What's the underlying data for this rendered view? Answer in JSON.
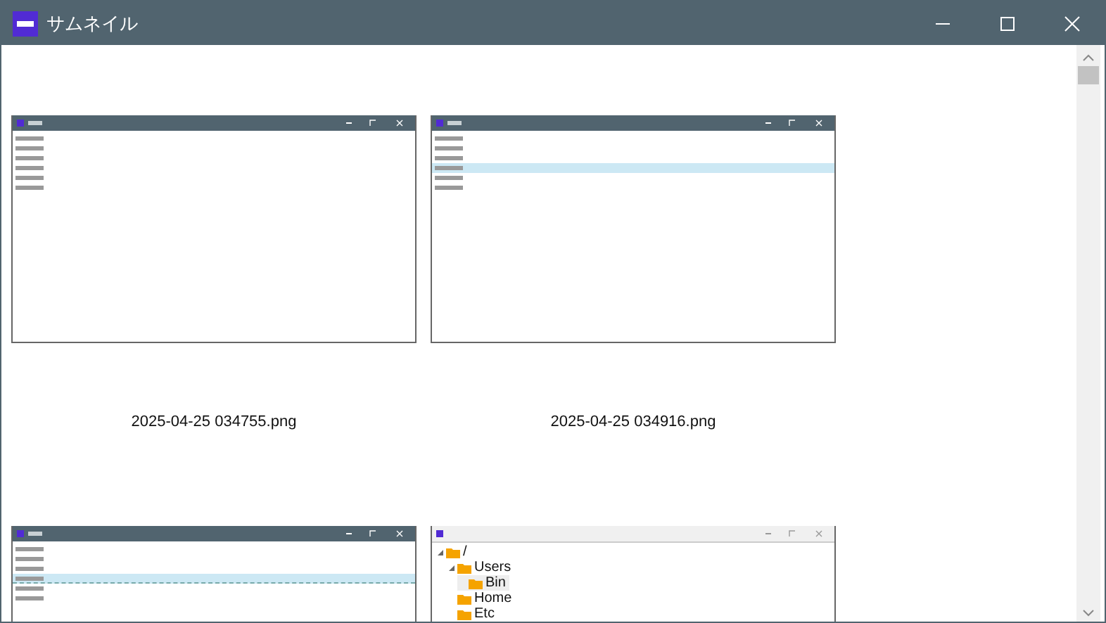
{
  "window": {
    "title": "サムネイル"
  },
  "thumbnails": [
    {
      "kind": "list",
      "caption": "2025-04-25 034755.png",
      "rows": [
        {
          "selected": false,
          "editing": false
        },
        {
          "selected": false,
          "editing": false
        },
        {
          "selected": false,
          "editing": false
        },
        {
          "selected": false,
          "editing": false
        },
        {
          "selected": false,
          "editing": false
        },
        {
          "selected": false,
          "editing": false
        }
      ]
    },
    {
      "kind": "list",
      "caption": "2025-04-25 034916.png",
      "rows": [
        {
          "selected": false,
          "editing": false
        },
        {
          "selected": false,
          "editing": false
        },
        {
          "selected": false,
          "editing": false
        },
        {
          "selected": true,
          "editing": false
        },
        {
          "selected": false,
          "editing": false
        },
        {
          "selected": false,
          "editing": false
        }
      ]
    },
    {
      "kind": "list",
      "rows": [
        {
          "selected": false,
          "editing": false
        },
        {
          "selected": false,
          "editing": false
        },
        {
          "selected": false,
          "editing": false
        },
        {
          "selected": true,
          "editing": true
        },
        {
          "selected": false,
          "editing": false
        },
        {
          "selected": false,
          "editing": false
        }
      ]
    },
    {
      "kind": "tree",
      "nodes": [
        {
          "label": "/",
          "expanded": true,
          "selected": false,
          "children": [
            {
              "label": "Users",
              "expanded": true,
              "selected": false,
              "children": [
                {
                  "label": "Bin",
                  "selected": true
                }
              ]
            },
            {
              "label": "Home",
              "selected": false
            },
            {
              "label": "Etc",
              "selected": false
            }
          ]
        }
      ]
    }
  ]
}
